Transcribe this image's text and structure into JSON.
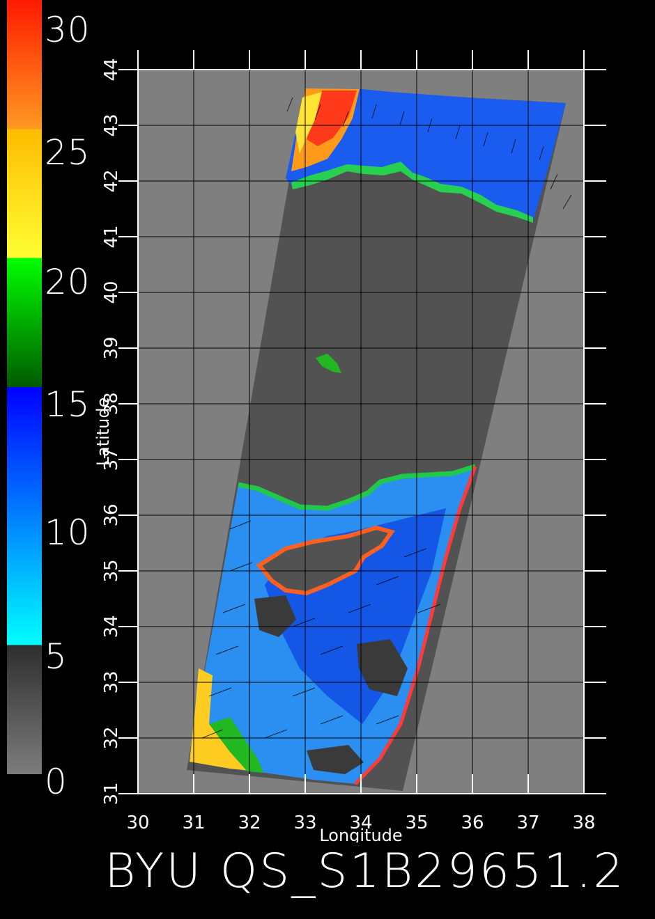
{
  "colorbar": {
    "labels": [
      "30",
      "25",
      "20",
      "15",
      "10",
      "5",
      "0"
    ],
    "stops": [
      {
        "value": 0,
        "color": "#7c7c7c"
      },
      {
        "value": 5,
        "color": "#2e2e2e"
      },
      {
        "value": 5,
        "color": "#00ffff"
      },
      {
        "value": 15,
        "color": "#0000ff"
      },
      {
        "value": 15,
        "color": "#005a00"
      },
      {
        "value": 20,
        "color": "#00ff00"
      },
      {
        "value": 20,
        "color": "#ffff33"
      },
      {
        "value": 25,
        "color": "#ffbb00"
      },
      {
        "value": 25,
        "color": "#ff9922"
      },
      {
        "value": 30,
        "color": "#ff1a00"
      }
    ]
  },
  "map": {
    "lon_range": [
      30,
      38
    ],
    "lat_range": [
      31,
      44
    ],
    "lon_ticks": [
      "30",
      "31",
      "32",
      "33",
      "34",
      "35",
      "36",
      "37",
      "38"
    ],
    "lat_ticks": [
      "31",
      "32",
      "33",
      "34",
      "35",
      "36",
      "37",
      "38",
      "39",
      "40",
      "41",
      "42",
      "43",
      "44"
    ],
    "xlabel": "Longitude",
    "ylabel": "Latitude",
    "colors": {
      "background": "#000000",
      "frame": "#7f7f7f",
      "land": "#525252",
      "grid": "#000000",
      "axis": "#ffffff"
    }
  },
  "footer": {
    "text": "BYU QS_S1B29651.2"
  }
}
